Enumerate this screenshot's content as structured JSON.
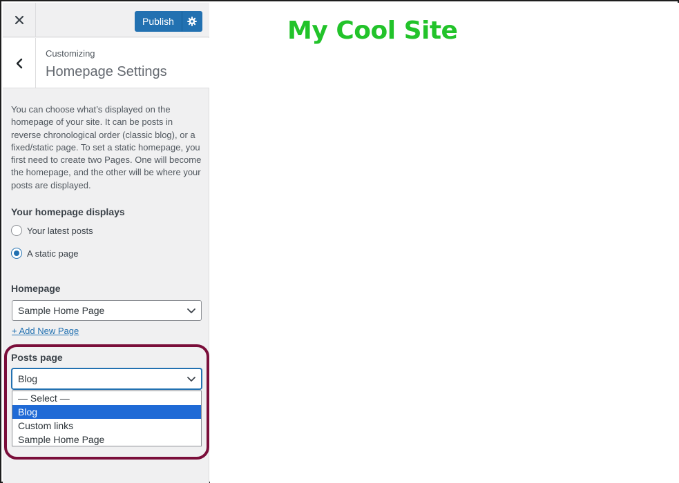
{
  "topbar": {
    "close_icon": "close-icon",
    "publish_label": "Publish",
    "gear_icon": "gear-icon"
  },
  "section": {
    "back_icon": "chevron-left-icon",
    "customizing_label": "Customizing",
    "title": "Homepage Settings"
  },
  "description": "You can choose what’s displayed on the homepage of your site. It can be posts in reverse chronological order (classic blog), or a fixed/static page. To set a static homepage, you first need to create two Pages. One will become the homepage, and the other will be where your posts are displayed.",
  "homepage_displays": {
    "title": "Your homepage displays",
    "options": [
      {
        "label": "Your latest posts",
        "checked": false
      },
      {
        "label": "A static page",
        "checked": true
      }
    ]
  },
  "homepage": {
    "title": "Homepage",
    "selected": "Sample Home Page",
    "add_link": "+ Add New Page"
  },
  "posts_page": {
    "title": "Posts page",
    "selected": "Blog",
    "options": [
      "— Select —",
      "Blog",
      "Custom links",
      "Sample Home Page"
    ]
  },
  "preview": {
    "site_title": "My Cool Site"
  },
  "colors": {
    "accent": "#2271b1",
    "site_title": "#22c32a",
    "highlight": "#7a0e3a",
    "dropdown_selected": "#1f6ad6"
  }
}
